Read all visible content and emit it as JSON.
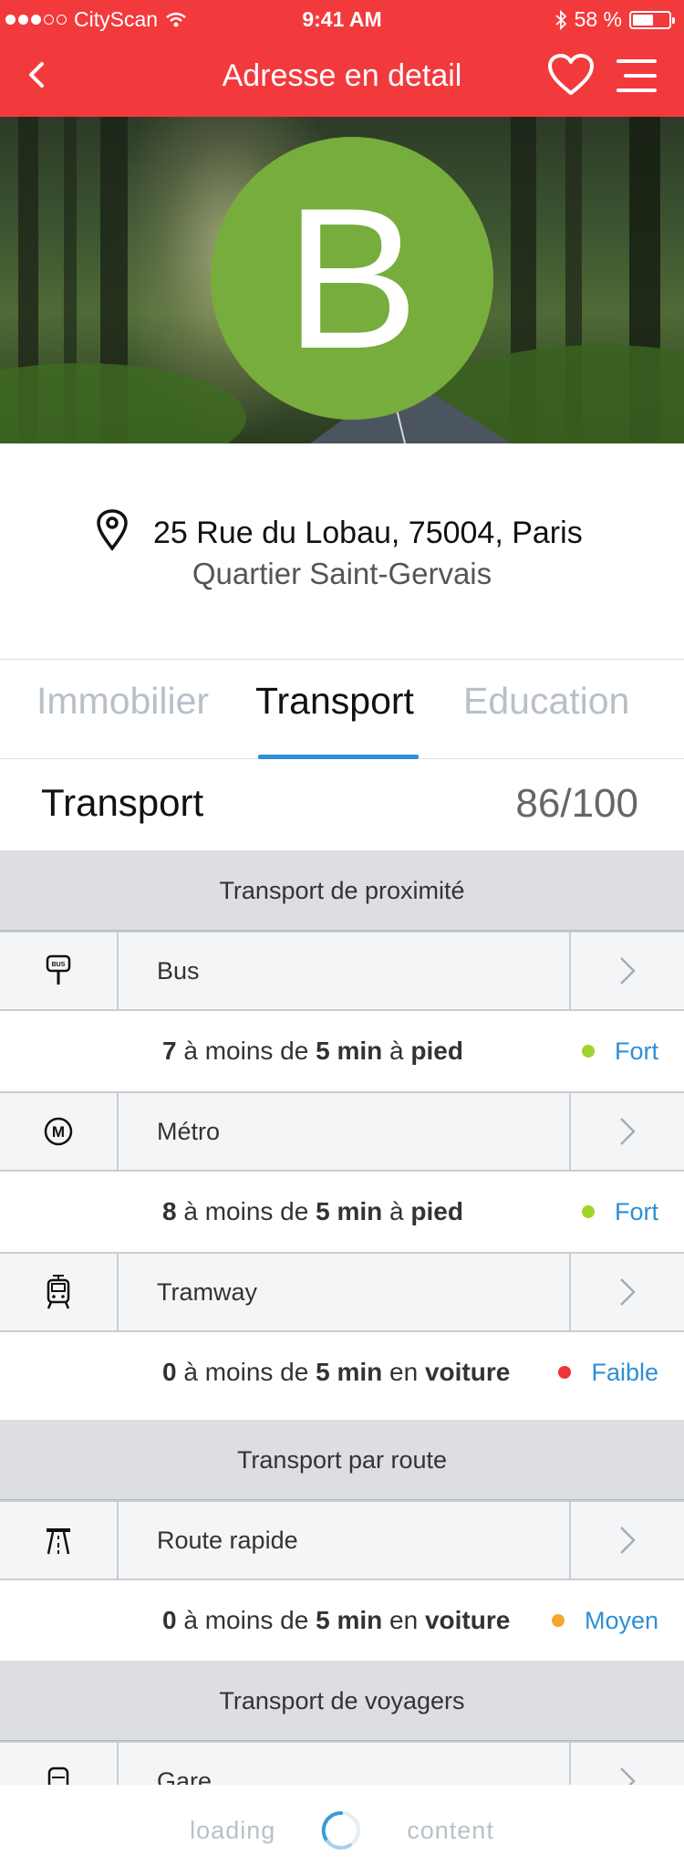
{
  "status_bar": {
    "carrier": "CityScan",
    "time": "9:41 AM",
    "battery": "58 %",
    "battery_level": 0.58
  },
  "nav": {
    "title": "Adresse en detail"
  },
  "hero": {
    "grade": "B",
    "grade_color": "#76ad3c"
  },
  "address": {
    "line1": "25 Rue du Lobau, 75004, Paris",
    "line2": "Quartier Saint-Gervais"
  },
  "tabs": [
    {
      "label": "Immobilier",
      "active": false
    },
    {
      "label": "Transport",
      "active": true
    },
    {
      "label": "Education",
      "active": false
    }
  ],
  "section": {
    "title": "Transport",
    "score": "86/100"
  },
  "groups": [
    {
      "title": "Transport de proximité"
    },
    {
      "title": "Transport par route"
    },
    {
      "title": "Transport de voyagers"
    }
  ],
  "items": [
    {
      "label": "Bus",
      "icon": "bus-stop-icon",
      "count": "7",
      "t1": "à moins de",
      "dur": "5 min",
      "t2": "à",
      "mode": "pied",
      "level": "Fort",
      "level_color": "#9fd42a"
    },
    {
      "label": "Métro",
      "icon": "metro-icon",
      "count": "8",
      "t1": "à moins de",
      "dur": "5 min",
      "t2": "à",
      "mode": "pied",
      "level": "Fort",
      "level_color": "#9fd42a"
    },
    {
      "label": "Tramway",
      "icon": "tram-icon",
      "count": "0",
      "t1": "à moins de",
      "dur": "5 min",
      "t2": "en",
      "mode": "voiture",
      "level": "Faible",
      "level_color": "#f0323a"
    },
    {
      "label": "Route rapide",
      "icon": "highway-icon",
      "count": "0",
      "t1": "à moins de",
      "dur": "5 min",
      "t2": "en",
      "mode": "voiture",
      "level": "Moyen",
      "level_color": "#f6a530"
    },
    {
      "label": "Gare",
      "icon": "train-icon"
    }
  ],
  "loading": {
    "left": "loading",
    "right": "content"
  },
  "colors": {
    "brand_red": "#f23a3d",
    "accent_blue": "#2d8fd6",
    "group_bg": "#dcdee2"
  }
}
